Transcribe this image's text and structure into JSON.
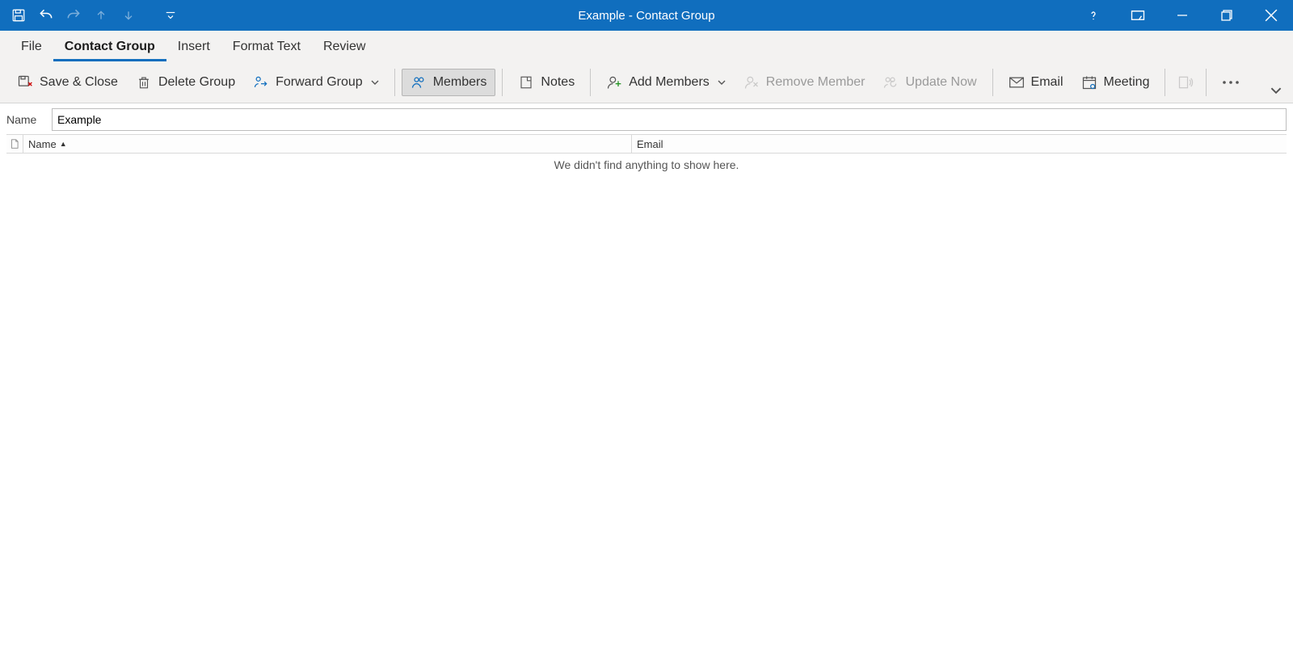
{
  "window": {
    "title": "Example  -  Contact Group"
  },
  "tabs": {
    "file": "File",
    "contact_group": "Contact Group",
    "insert": "Insert",
    "format_text": "Format Text",
    "review": "Review"
  },
  "ribbon": {
    "save_close": "Save & Close",
    "delete_group": "Delete Group",
    "forward_group": "Forward Group",
    "members": "Members",
    "notes": "Notes",
    "add_members": "Add Members",
    "remove_member": "Remove Member",
    "update_now": "Update Now",
    "email": "Email",
    "meeting": "Meeting"
  },
  "name_field": {
    "label": "Name",
    "value": "Example"
  },
  "columns": {
    "name": "Name",
    "email": "Email"
  },
  "empty_message": "We didn't find anything to show here."
}
